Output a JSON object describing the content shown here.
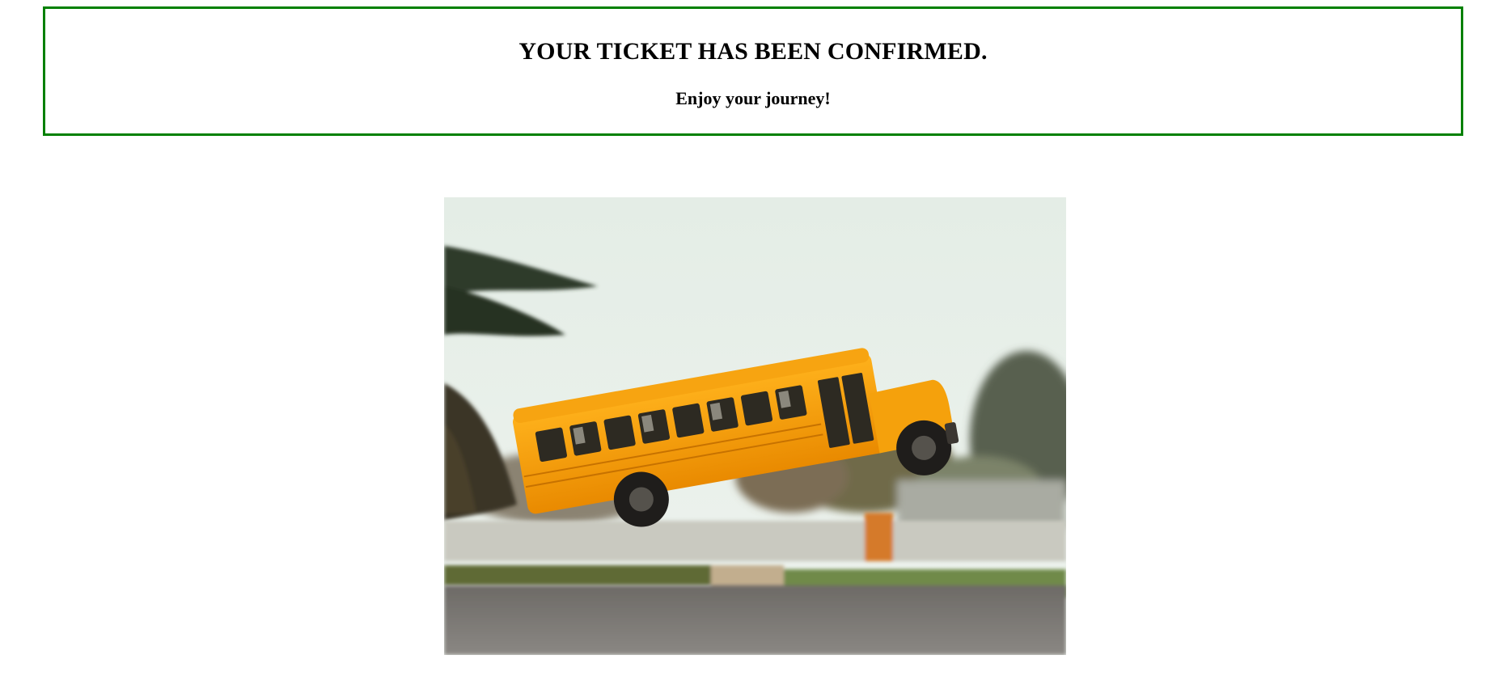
{
  "confirmation": {
    "title": "YOUR TICKET HAS BEEN CONFIRMED.",
    "subtitle": "Enjoy your journey!",
    "border_color": "#008000"
  },
  "image": {
    "subject": "yellow-school-bus-flying"
  }
}
